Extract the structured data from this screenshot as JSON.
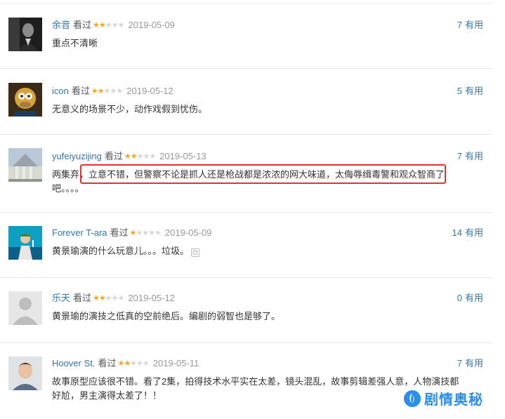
{
  "comments": [
    {
      "user": "余音",
      "watched": "看过",
      "rating": 2,
      "date": "2019-05-09",
      "votes": "7",
      "votes_label": "有用",
      "text": "重点不清晰",
      "avatar": "dark-portrait"
    },
    {
      "user": "icon",
      "watched": "看过",
      "rating": 2,
      "date": "2019-05-12",
      "votes": "5",
      "votes_label": "有用",
      "text": "无意义的场景不少，动作戏假到忧伤。",
      "avatar": "homer-painting"
    },
    {
      "user": "yufeiyuzijing",
      "watched": "看过",
      "rating": 2,
      "date": "2019-05-13",
      "votes": "7",
      "votes_label": "有用",
      "text": "两集弃，立意不错，但警察不论是抓人还是枪战都是浓浓的网大味道，太侮辱缉毒警和观众智商了吧。。。。",
      "avatar": "building-photo"
    },
    {
      "user": "Forever T-ara",
      "watched": "看过",
      "rating": 1,
      "date": "2019-05-09",
      "votes": "14",
      "votes_label": "有用",
      "text": "黄景瑜演的什么玩意儿。。。垃圾。",
      "avatar": "stage-performer"
    },
    {
      "user": "乐天",
      "watched": "看过",
      "rating": 2,
      "date": "2019-05-12",
      "votes": "0",
      "votes_label": "有用",
      "text": "黄景瑜的演技之低真的空前绝后。编剧的弱智也是够了。",
      "avatar": "default-avatar"
    },
    {
      "user": "Hoover St.",
      "watched": "看过",
      "rating": 2,
      "date": "2019-05-11",
      "votes": "7",
      "votes_label": "有用",
      "text": "故事原型应该很不错。看了2集，拍得技术水平实在太差，镜头混乱，故事剪辑差强人意，人物演技都好尬，男主演得太差了！！",
      "avatar": "young-man-photo"
    }
  ],
  "watermark": {
    "text": "剧情奥秘",
    "icon": "logo-icon"
  },
  "colors": {
    "username": "#3377aa",
    "star_on": "#f5a623",
    "star_off": "#d6d6d6",
    "highlight": "#e8332a",
    "watermark": "#2b8ee8"
  }
}
